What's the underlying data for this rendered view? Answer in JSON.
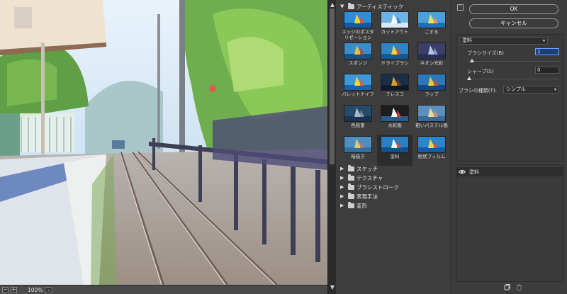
{
  "preview": {
    "zoom_minus": "−",
    "zoom_plus": "+",
    "zoom_value": "100%"
  },
  "gallery": {
    "open_category": "アーティスティック",
    "thumbnails": [
      {
        "label": "エッジのポスタリゼーション"
      },
      {
        "label": "カットアウト"
      },
      {
        "label": "こする"
      },
      {
        "label": "スポンジ"
      },
      {
        "label": "ドライブラシ"
      },
      {
        "label": "ネオン光彩"
      },
      {
        "label": "パレットナイフ"
      },
      {
        "label": "フレスコ"
      },
      {
        "label": "ラップ"
      },
      {
        "label": "色鉛筆"
      },
      {
        "label": "水彩画"
      },
      {
        "label": "粗いパステル画"
      },
      {
        "label": "暗描き"
      },
      {
        "label": "塗料"
      },
      {
        "label": "粒状フィルム"
      }
    ],
    "selected": "塗料",
    "collapsed_categories": [
      "スケッチ",
      "テクスチャ",
      "ブラシストローク",
      "表現手法",
      "変形"
    ]
  },
  "settings": {
    "ok_label": "OK",
    "cancel_label": "キャンセル",
    "filter_name": "塗料",
    "brush_size_label": "ブラシサイズ(B)",
    "brush_size_value": "1",
    "sharpness_label": "シャープ(S)",
    "sharpness_value": "0",
    "brush_type_label": "ブラシの種類(T):",
    "brush_type_value": "シンプル",
    "layer_name": "塗料"
  },
  "colors": {
    "panel_bg": "#3c3c3c",
    "accent": "#1c3f7a",
    "selected_thumb_bg": "#2c2c2c"
  }
}
